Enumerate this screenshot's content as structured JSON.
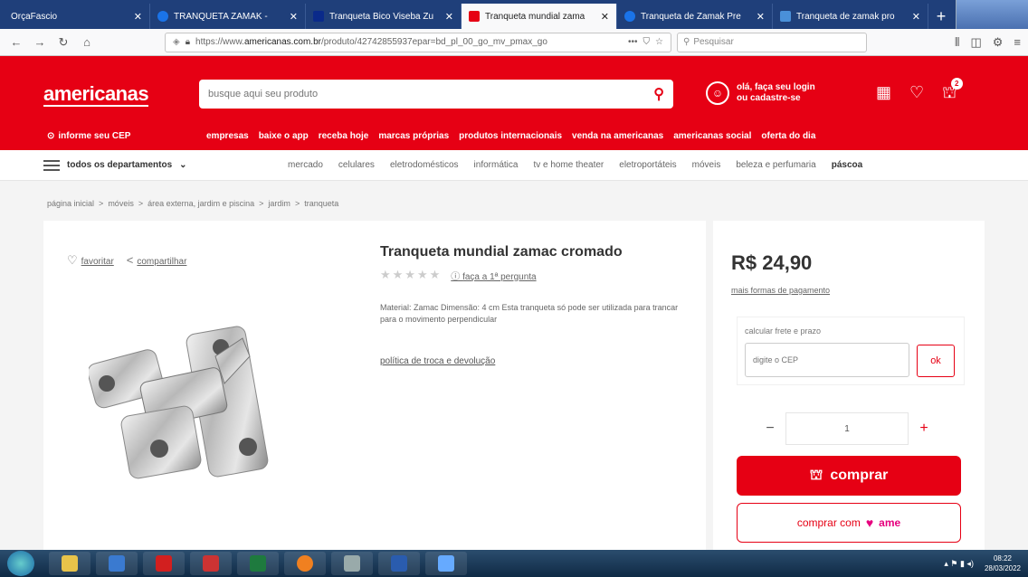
{
  "browser": {
    "tabs": [
      {
        "title": "OrçaFascio",
        "active": false,
        "color": "#ffffff"
      },
      {
        "title": "TRANQUETA ZAMAK -",
        "active": false,
        "color": "#1a73e8"
      },
      {
        "title": "Tranqueta Bico Viseba Zu",
        "active": false,
        "color": "#0a2a8a"
      },
      {
        "title": "Tranqueta mundial zama",
        "active": true,
        "color": "#e60014"
      },
      {
        "title": "Tranqueta de Zamak Pre",
        "active": false,
        "color": "#1a73e8"
      },
      {
        "title": "Tranqueta de zamak pro",
        "active": false,
        "color": "#4a90d9"
      }
    ],
    "url_prefix": "https://www.",
    "url_domain": "americanas.com.br",
    "url_rest": "/produto/42742855937epar=bd_pl_00_go_mv_pmax_go",
    "search_placeholder": "Pesquisar"
  },
  "header": {
    "logo": "americanas",
    "search_placeholder": "busque aqui seu produto",
    "login_line1": "olá, faça seu login",
    "login_line2": "ou cadastre-se",
    "cart_count": "2",
    "cep": "informe seu CEP",
    "links": [
      "empresas",
      "baixe o app",
      "receba hoje",
      "marcas próprias",
      "produtos internacionais",
      "venda na americanas",
      "americanas social",
      "oferta do dia"
    ]
  },
  "departments": {
    "all_label": "todos os departamentos",
    "items": [
      "mercado",
      "celulares",
      "eletrodomésticos",
      "informática",
      "tv e home theater",
      "eletroportáteis",
      "móveis",
      "beleza e perfumaria",
      "páscoa"
    ]
  },
  "breadcrumb": [
    "página inicial",
    ">",
    "móveis",
    ">",
    "área externa, jardim e piscina",
    ">",
    "jardim",
    ">",
    "tranqueta"
  ],
  "product": {
    "favorite": "favoritar",
    "share": "compartilhar",
    "title": "Tranqueta mundial zamac cromado",
    "question_link": "faça a 1ª pergunta",
    "description": "Material: Zamac Dimensão: 4 cm Esta tranqueta só pode ser utilizada para trancar para o movimento perpendicular",
    "policy": "política de troca e devolução"
  },
  "buybox": {
    "price": "R$ 24,90",
    "payment_link": "mais formas de pagamento",
    "freight_label": "calcular frete e prazo",
    "cep_placeholder": "digite o CEP",
    "ok": "ok",
    "quantity": "1",
    "minus": "−",
    "plus": "+",
    "buy_label": "comprar",
    "ame_label": "comprar com",
    "ame_brand": "ame"
  },
  "taskbar": {
    "time": "08:22",
    "date": "28/03/2022"
  },
  "colors": {
    "brand_red": "#e60014",
    "ame_pink": "#e6007e"
  }
}
